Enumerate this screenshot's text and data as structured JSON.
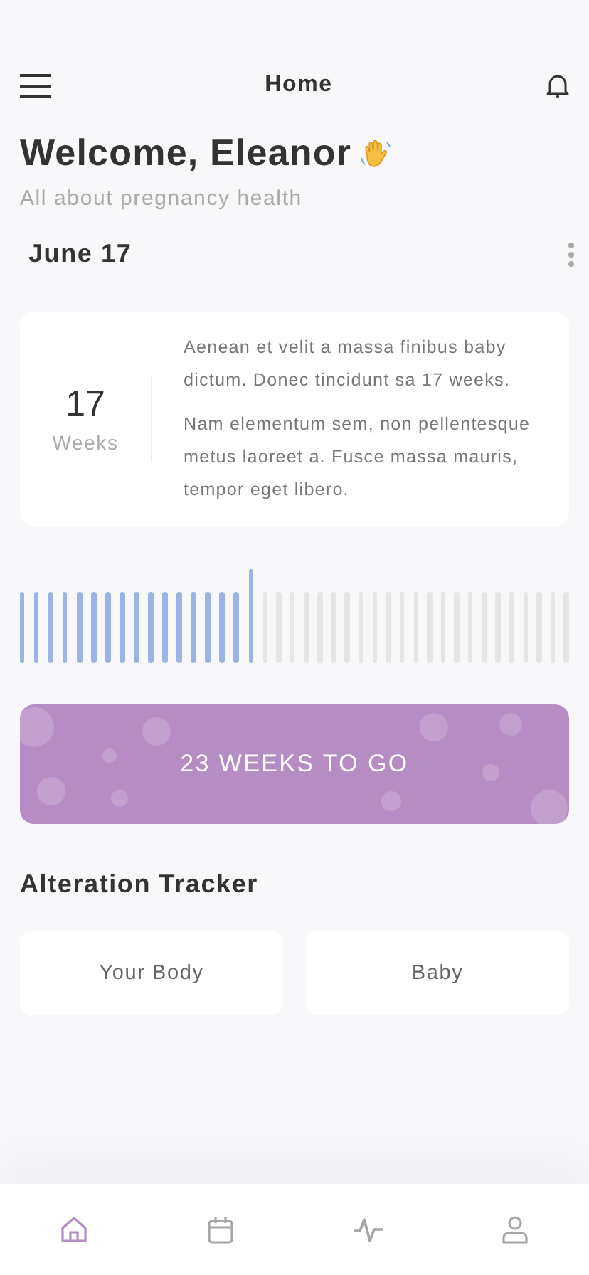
{
  "header": {
    "title": "Home"
  },
  "welcome": {
    "title": "Welcome, Eleanor",
    "subtitle": "All about pregnancy health"
  },
  "date": "June 17",
  "summary": {
    "number": "17",
    "unit": "Weeks",
    "paragraphs": [
      "Aenean et velit a massa finibus baby dictum. Donec tincidunt sa 17 weeks.",
      "Nam elementum sem, non pellentesque metus laoreet a. Fusce massa mauris, tempor eget libero."
    ]
  },
  "banner": {
    "text": "23 WEEKS TO GO"
  },
  "tracker": {
    "title": "Alteration Tracker",
    "buttons": [
      "Your Body",
      "Baby"
    ]
  },
  "bottom_nav": [
    {
      "selected": true
    },
    {
      "selected": false
    },
    {
      "selected": false
    },
    {
      "selected": false
    }
  ]
}
